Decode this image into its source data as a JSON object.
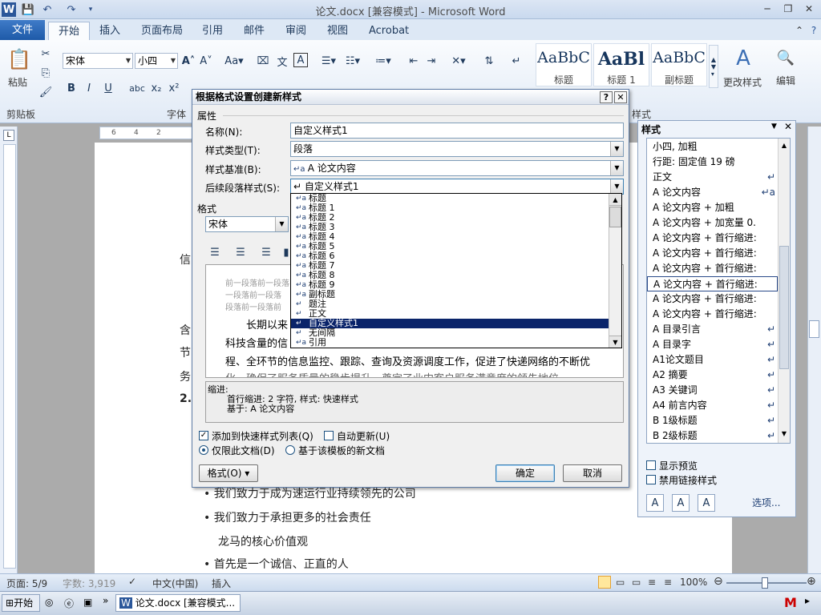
{
  "window": {
    "title": "论文.docx [兼容模式] - Microsoft Word",
    "app_icon": "W"
  },
  "tabs": [
    "文件",
    "开始",
    "插入",
    "页面布局",
    "引用",
    "邮件",
    "审阅",
    "视图",
    "Acrobat"
  ],
  "ribbon": {
    "clipboard": {
      "paste_label": "粘贴",
      "group_label": "剪贴板"
    },
    "font": {
      "name": "宋体",
      "size": "小四",
      "group_label": "字体"
    },
    "style_gallery": [
      {
        "sample": "AaBbC",
        "name": "标题"
      },
      {
        "sample": "AaBl",
        "name": "标题 1"
      },
      {
        "sample": "AaBbC",
        "name": "副标题"
      }
    ],
    "change_styles_label": "更改样式",
    "editing_label": "编辑",
    "styles_group_label": "样式"
  },
  "ruler": {
    "ticks": [
      "6",
      "4",
      "2"
    ]
  },
  "document": {
    "lines": [
      "信",
      "含",
      "节",
      "务",
      "2.",
      "• 我们致力于成为速运行业持续领先的公司",
      "• 我们致力于承担更多的社会责任",
      "龙马的核心价值观",
      "• 首先是一个诚信、正直的人"
    ]
  },
  "status": {
    "page": "页面: 5/9",
    "words": "字数: 3,919",
    "language": "中文(中国)",
    "insert_mode": "插入",
    "zoom": "100%"
  },
  "taskbar": {
    "start": "开始",
    "task": "论文.docx [兼容模式..."
  },
  "styles_pane": {
    "title": "样式",
    "items": [
      {
        "label": "小四, 加粗",
        "mark": ""
      },
      {
        "label": "行距: 固定值 19 磅",
        "mark": ""
      },
      {
        "label": "正文",
        "mark": "↵"
      },
      {
        "label": "A 论文内容",
        "mark": "↵a"
      },
      {
        "label": "A 论文内容 + 加粗",
        "mark": ""
      },
      {
        "label": "A 论文内容 + 加宽量 0.",
        "mark": ""
      },
      {
        "label": "A 论文内容 + 首行缩进:",
        "mark": ""
      },
      {
        "label": "A 论文内容 + 首行缩进:",
        "mark": ""
      },
      {
        "label": "A 论文内容 + 首行缩进:",
        "mark": ""
      },
      {
        "label": "A 论文内容 + 首行缩进:",
        "mark": ""
      },
      {
        "label": "A 论文内容 + 首行缩进:",
        "mark": ""
      },
      {
        "label": "A 论文内容 + 首行缩进:",
        "mark": ""
      },
      {
        "label": "A 目录引言",
        "mark": "↵"
      },
      {
        "label": "A 目录字",
        "mark": "↵"
      },
      {
        "label": "A1论文题目",
        "mark": "↵"
      },
      {
        "label": "A2 摘要",
        "mark": "↵"
      },
      {
        "label": "A3 关键词",
        "mark": "↵"
      },
      {
        "label": "A4 前言内容",
        "mark": "↵"
      },
      {
        "label": "B 1级标题",
        "mark": "↵"
      },
      {
        "label": "B 2级标题",
        "mark": "↵"
      }
    ],
    "selected_index": 9,
    "show_preview": "显示预览",
    "disable_linked": "禁用链接样式",
    "options": "选项..."
  },
  "dialog": {
    "title": "根据格式设置创建新样式",
    "help": "?",
    "close": "✕",
    "properties_section": "属性",
    "name_label": "名称(N):",
    "name_value": "自定义样式1",
    "type_label": "样式类型(T):",
    "type_value": "段落",
    "based_label": "样式基准(B):",
    "based_value": "A 论文内容",
    "next_label": "后续段落样式(S):",
    "next_value": "自定义样式1",
    "format_section": "格式",
    "font_value": "宋体",
    "preview_lines": [
      "前一段落前一段落",
      "一段落前一段落",
      "段落前一段落前",
      "长期以来",
      "科技含量的信",
      "程、全环节的信息监控、跟踪、查询及资源调度工作，促进了快递网络的不断优",
      "化，确保了服务质量的稳步提升，奠定了业内客户服务满意度的领先地位"
    ],
    "description_lines": [
      "缩进:",
      "首行缩进:  2 字符, 样式: 快速样式",
      "基于: A 论文内容"
    ],
    "add_quick_label": "添加到快速样式列表(Q)",
    "auto_update_label": "自动更新(U)",
    "this_doc_label": "仅限此文档(D)",
    "new_docs_label": "基于该模板的新文档",
    "format_button": "格式(O) ▾",
    "ok_button": "确定",
    "cancel_button": "取消",
    "dropdown_items": [
      {
        "label": "标题",
        "mark": "↵a"
      },
      {
        "label": "标题 1",
        "mark": "↵a"
      },
      {
        "label": "标题 2",
        "mark": "↵a"
      },
      {
        "label": "标题 3",
        "mark": "↵a"
      },
      {
        "label": "标题 4",
        "mark": "↵a"
      },
      {
        "label": "标题 5",
        "mark": "↵a"
      },
      {
        "label": "标题 6",
        "mark": "↵a"
      },
      {
        "label": "标题 7",
        "mark": "↵a"
      },
      {
        "label": "标题 8",
        "mark": "↵a"
      },
      {
        "label": "标题 9",
        "mark": "↵a"
      },
      {
        "label": "副标题",
        "mark": "↵a"
      },
      {
        "label": "题注",
        "mark": "↵"
      },
      {
        "label": "正文",
        "mark": "↵"
      },
      {
        "label": "自定义样式1",
        "mark": "↵"
      },
      {
        "label": "无间隔",
        "mark": "↵"
      },
      {
        "label": "引用",
        "mark": "↵a"
      }
    ],
    "dropdown_selected": 13
  }
}
